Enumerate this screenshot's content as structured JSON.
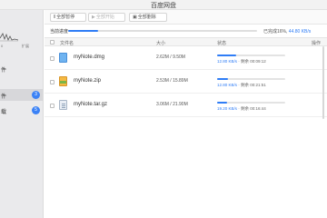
{
  "window": {
    "title": "百度网盘"
  },
  "sidebar": {
    "count_label": "0",
    "expand_label": "扩展",
    "items": [
      {
        "label": "件",
        "badge": ""
      },
      {
        "label": "件",
        "badge": "3"
      },
      {
        "label": "载",
        "badge": "5"
      }
    ]
  },
  "toolbar": {
    "pause_all": "全部暂停",
    "start_all": "全部开始",
    "delete_all": "全部删除"
  },
  "progress": {
    "label": "当前进度",
    "percent": 16,
    "done_text": "已完成16%,",
    "speed": "44.80 KB/s"
  },
  "table": {
    "headers": {
      "name": "文件名",
      "size": "大小",
      "status": "状态",
      "action": "操作"
    },
    "rows": [
      {
        "name": "myNote.dmg",
        "icon": "dmg-file-icon",
        "size": "2.62M / 9.50M",
        "progress": 28,
        "speed": "12.80 KB/s",
        "remain": "· 剩余 00:09:12"
      },
      {
        "name": "myNote.zip",
        "icon": "zip-file-icon",
        "size": "2.53M / 15.89M",
        "progress": 16,
        "speed": "12.80 KB/s",
        "remain": "· 剩余 00:21:51"
      },
      {
        "name": "myNote.tar.gz",
        "icon": "archive-file-icon",
        "size": "3.06M / 21.90M",
        "progress": 14,
        "speed": "19.20 KB/s",
        "remain": "· 剩余 00:16:44"
      }
    ]
  }
}
